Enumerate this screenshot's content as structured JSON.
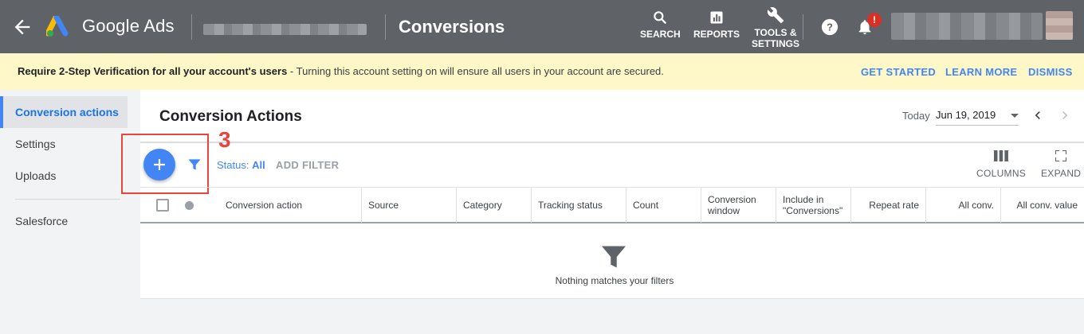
{
  "topbar": {
    "brand": "Google Ads",
    "page_title": "Conversions",
    "tools": [
      {
        "label": "SEARCH",
        "icon": "search-icon"
      },
      {
        "label": "REPORTS",
        "icon": "reports-icon"
      },
      {
        "label_line1": "TOOLS &",
        "label_line2": "SETTINGS",
        "icon": "wrench-icon"
      }
    ],
    "notification_badge": "!"
  },
  "notice": {
    "bold": "Require 2-Step Verification for all your account's users",
    "text": " - Turning this account setting on will ensure all users in your account are secured.",
    "actions": [
      "GET STARTED",
      "LEARN MORE",
      "DISMISS"
    ]
  },
  "sidebar": {
    "items": [
      "Conversion actions",
      "Settings",
      "Uploads",
      "Salesforce"
    ],
    "active_index": 0
  },
  "main": {
    "title": "Conversion Actions",
    "date_label": "Today",
    "date_value": "Jun 19, 2019",
    "status_label": "Status: ",
    "status_value": "All",
    "add_filter": "ADD FILTER",
    "columns_label": "COLUMNS",
    "expand_label": "EXPAND",
    "annotation": "3",
    "table_headers": [
      "Conversion action",
      "Source",
      "Category",
      "Tracking status",
      "Count",
      "Conversion window",
      "Include in \"Conversions\"",
      "Repeat rate",
      "All conv.",
      "All conv. value"
    ],
    "empty_message": "Nothing matches your filters"
  },
  "colors": {
    "topbar": "#5f6368",
    "accent": "#4285f4",
    "notice_bg": "#fef7c7",
    "annotation": "#e8453c"
  }
}
